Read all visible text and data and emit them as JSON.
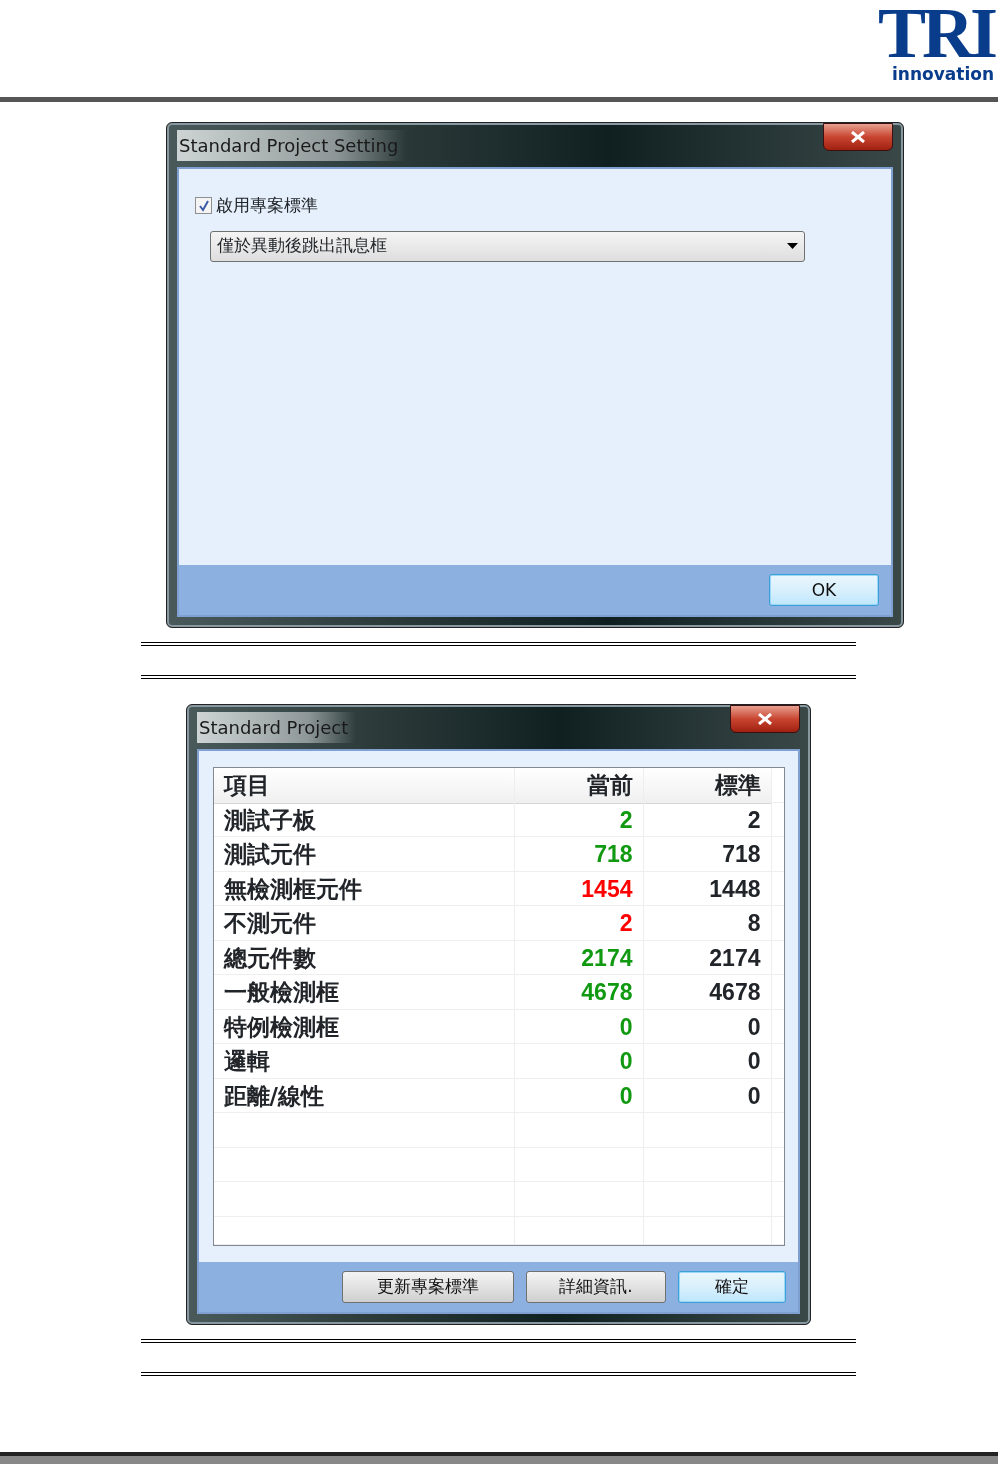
{
  "logo": {
    "letters": "TRI",
    "tagline": "innovation"
  },
  "settings_dialog": {
    "title": "Standard Project Setting",
    "checkbox": {
      "label": "啟用專案標準",
      "checked": true
    },
    "dropdown": {
      "value": "僅於異動後跳出訊息框"
    },
    "buttons": [
      {
        "label": "OK",
        "default": true
      }
    ]
  },
  "project_dialog": {
    "title": "Standard Project",
    "table": {
      "columns": [
        "項目",
        "當前",
        "標準"
      ],
      "rows": [
        {
          "item": "測試子板",
          "current": "2",
          "color": "#119911",
          "standard": "2"
        },
        {
          "item": "測試元件",
          "current": "718",
          "color": "#119911",
          "standard": "718"
        },
        {
          "item": "無檢測框元件",
          "current": "1454",
          "color": "#ff0000",
          "standard": "1448"
        },
        {
          "item": "不測元件",
          "current": "2",
          "color": "#ff0000",
          "standard": "8"
        },
        {
          "item": "總元件數",
          "current": "2174",
          "color": "#119911",
          "standard": "2174"
        },
        {
          "item": "一般檢測框",
          "current": "4678",
          "color": "#119911",
          "standard": "4678"
        },
        {
          "item": "特例檢測框",
          "current": "0",
          "color": "#119911",
          "standard": "0"
        },
        {
          "item": "邏輯",
          "current": "0",
          "color": "#119911",
          "standard": "0"
        },
        {
          "item": "距離/線性",
          "current": "0",
          "color": "#119911",
          "standard": "0"
        }
      ]
    },
    "buttons": [
      {
        "label": "更新專案標準",
        "default": false
      },
      {
        "label": "詳細資訊.",
        "default": false
      },
      {
        "label": "確定",
        "default": true
      }
    ]
  }
}
